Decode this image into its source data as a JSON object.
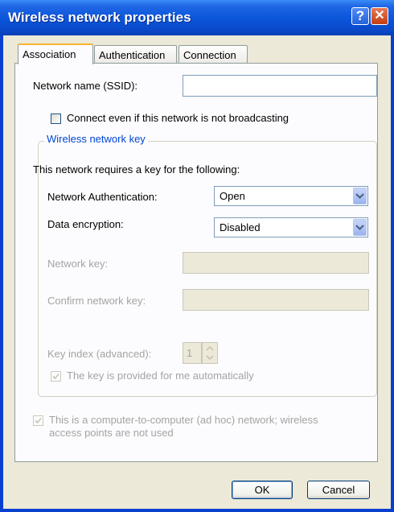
{
  "window": {
    "title": "Wireless network properties"
  },
  "tabs": [
    "Association",
    "Authentication",
    "Connection"
  ],
  "ssid": {
    "label": "Network name (SSID):",
    "value": ""
  },
  "connect_hidden": {
    "label": "Connect even if this network is not broadcasting",
    "checked": false
  },
  "key_group": {
    "title": "Wireless network key",
    "intro": "This network requires a key for the following:",
    "auth_label": "Network Authentication:",
    "auth_value": "Open",
    "encryption_label": "Data encryption:",
    "encryption_value": "Disabled",
    "key_label": "Network key:",
    "confirm_label": "Confirm network key:",
    "index_label": "Key index (advanced):",
    "index_value": "1",
    "auto_label": "The key is provided for me automatically",
    "auto_checked": true
  },
  "adhoc": {
    "label_line1": "This is a computer-to-computer (ad hoc) network; wireless",
    "label_line2": "access points are not used",
    "checked": true
  },
  "buttons": {
    "ok": "OK",
    "cancel": "Cancel"
  }
}
